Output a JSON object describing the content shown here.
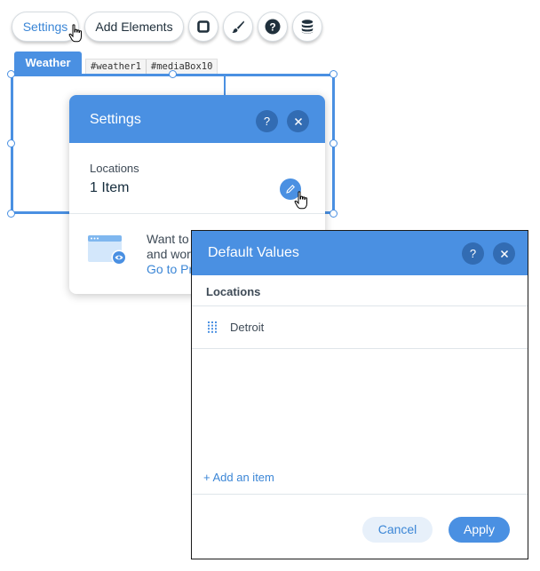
{
  "toolbar": {
    "settings_label": "Settings",
    "add_elements_label": "Add Elements",
    "icons": [
      "square-icon",
      "brush-icon",
      "help-icon",
      "database-icon"
    ]
  },
  "element": {
    "tab_label": "Weather",
    "ids": [
      "#weather1",
      "#mediaBox10"
    ]
  },
  "settings_panel": {
    "title": "Settings",
    "help_label": "?",
    "locations_label": "Locations",
    "locations_count": "1 Item",
    "promo_line1": "Want to",
    "promo_line2": "and wor",
    "promo_link": "Go to Pr"
  },
  "default_values": {
    "title": "Default Values",
    "help_label": "?",
    "column_label": "Locations",
    "items": [
      {
        "label": "Detroit"
      }
    ],
    "add_item_label": "+ Add an item",
    "cancel_label": "Cancel",
    "apply_label": "Apply"
  },
  "colors": {
    "accent": "#4a90e2",
    "link": "#3b86d6",
    "text": "#20303c"
  }
}
